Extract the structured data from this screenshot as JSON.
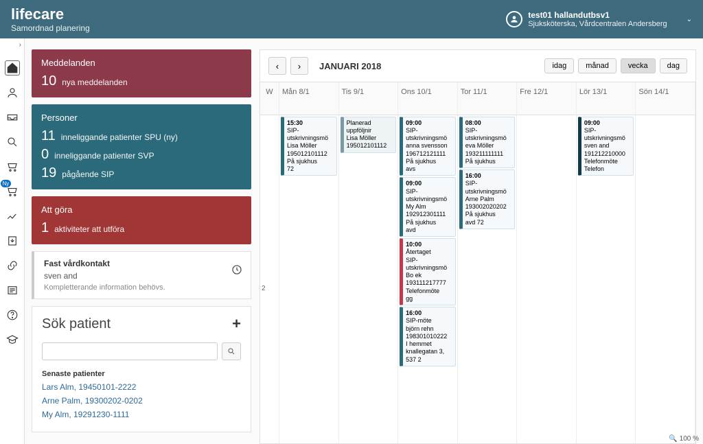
{
  "header": {
    "logo": "lifecare",
    "subtitle": "Samordnad planering",
    "user_name": "test01 hallandutbsv1",
    "user_role": "Sjuksköterska, Vårdcentralen Andersberg"
  },
  "messages_card": {
    "title": "Meddelanden",
    "count": "10",
    "label": "nya meddelanden"
  },
  "personer_card": {
    "title": "Personer",
    "rows": [
      {
        "n": "11",
        "label": "inneliggande patienter SPU (ny)"
      },
      {
        "n": "0",
        "label": "inneliggande patienter SVP"
      },
      {
        "n": "19",
        "label": "pågående SIP"
      }
    ]
  },
  "attgora_card": {
    "title": "Att göra",
    "count": "1",
    "label": "aktiviteter att utföra"
  },
  "fast_card": {
    "title": "Fast vårdkontakt",
    "name": "sven and",
    "sub": "Kompletterande information behövs."
  },
  "search": {
    "title": "Sök patient",
    "recent_title": "Senaste patienter",
    "recent": [
      "Lars Alm, 19450101-2222",
      "Arne Palm, 19300202-0202",
      "My Alm, 19291230-1111"
    ]
  },
  "calendar": {
    "title": "JANUARI 2018",
    "views": {
      "today": "idag",
      "month": "månad",
      "week": "vecka",
      "day": "dag"
    },
    "wk_label": "W",
    "week_num": "2",
    "days": [
      "Mån 8/1",
      "Tis 9/1",
      "Ons 10/1",
      "Tor 11/1",
      "Fre 12/1",
      "Lör 13/1",
      "Sön 14/1"
    ],
    "events": {
      "mon": [
        {
          "cls": "ev-teal",
          "time": "15:30",
          "lines": [
            "SIP-utskrivningsmö",
            "Lisa Möller",
            "195012101112",
            "På sjukhus",
            "72"
          ]
        }
      ],
      "tue": [
        {
          "cls": "ev-gray",
          "time": "",
          "lines": [
            "Planerad uppföljnir",
            "Lisa Möller",
            "195012101112"
          ]
        }
      ],
      "wed": [
        {
          "cls": "ev-teal",
          "time": "09:00",
          "lines": [
            "SIP-utskrivningsmö",
            "anna svensson",
            "196712121111",
            "På sjukhus",
            "avs"
          ]
        },
        {
          "cls": "ev-teal",
          "time": "09:00",
          "lines": [
            "SIP-utskrivningsmö",
            "My Alm",
            "192912301111",
            "På sjukhus",
            "avd"
          ]
        },
        {
          "cls": "ev-red",
          "time": "10:00",
          "lines": [
            "Återtaget",
            "SIP-utskrivningsmö",
            "Bo ek",
            "193111217777",
            "Telefonmöte",
            "gg"
          ]
        },
        {
          "cls": "ev-teal",
          "time": "16:00",
          "lines": [
            "SIP-möte",
            "björn rehn",
            "198301010222",
            "I hemmet",
            "knallegatan 3, 537 2"
          ]
        }
      ],
      "thu": [
        {
          "cls": "ev-teal",
          "time": "08:00",
          "lines": [
            "SIP-utskrivningsmö",
            "eva Möller",
            "193211111111",
            "På sjukhus"
          ]
        },
        {
          "cls": "ev-teal",
          "time": "16:00",
          "lines": [
            "SIP-utskrivningsmö",
            "Arne Palm",
            "193002020202",
            "På sjukhus",
            "avd 72"
          ]
        }
      ],
      "fri": [],
      "sat": [
        {
          "cls": "ev-dark",
          "time": "09:00",
          "lines": [
            "SIP-utskrivningsmö",
            "sven and",
            "191212210000",
            "Telefonmöte",
            "Telefon"
          ]
        }
      ],
      "sun": []
    }
  },
  "footer_zoom": "100 %"
}
